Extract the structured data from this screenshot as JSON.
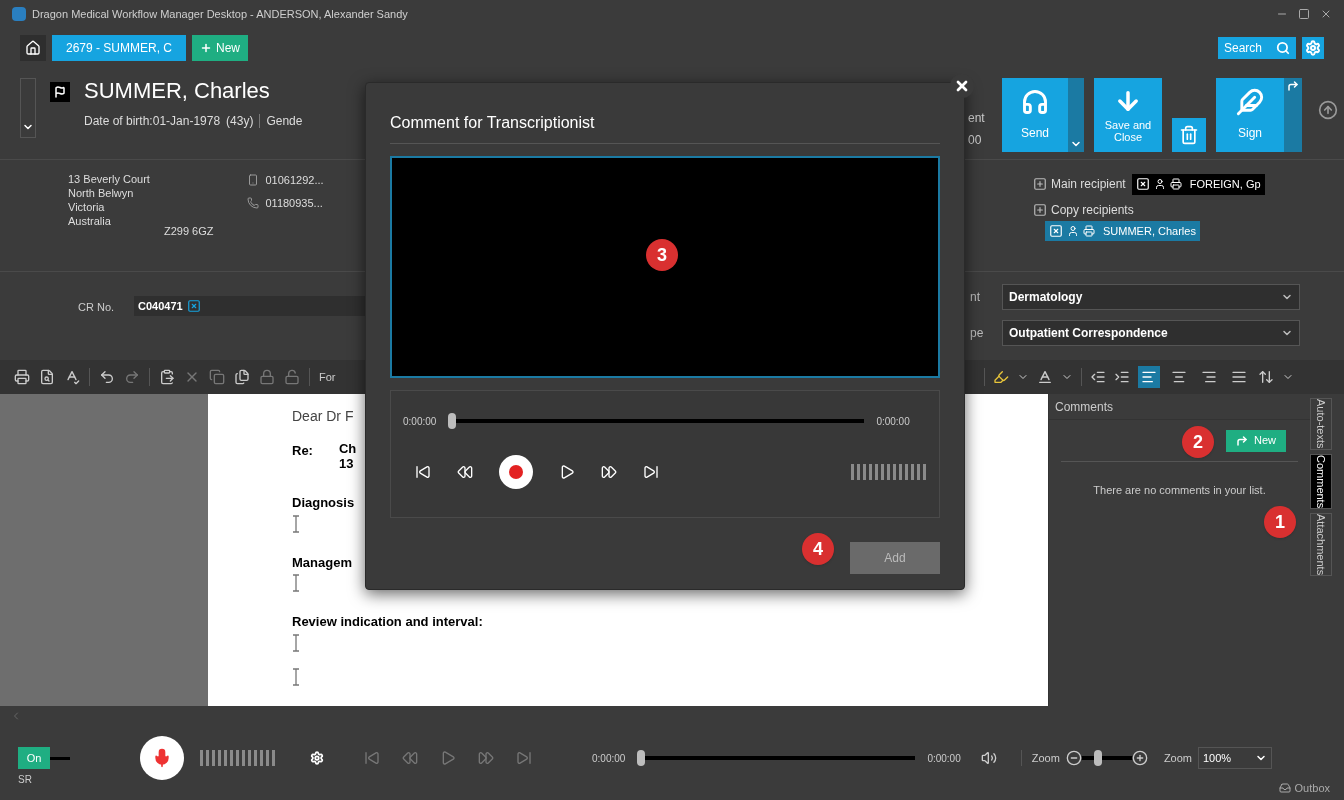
{
  "window": {
    "title": "Dragon Medical Workflow Manager Desktop - ANDERSON, Alexander Sandy"
  },
  "tabs": [
    {
      "label": "2679 - SUMMER, C",
      "selected": true
    }
  ],
  "new_tab_button": {
    "label": "New"
  },
  "search_button": {
    "label": "Search"
  },
  "patient": {
    "name": "SUMMER, Charles",
    "dob": "Date of birth:01-Jan-1978",
    "age": "(43y)",
    "gender_label": "Gende",
    "address": [
      "13 Beverly Court",
      "North Belwyn",
      "Victoria",
      "Australia"
    ],
    "postcode": "Z299 6GZ",
    "phones": [
      "01061292...",
      "01180935..."
    ]
  },
  "header_fragments": [
    "ent",
    "00"
  ],
  "actions": [
    {
      "label": "Send",
      "kind": "split"
    },
    {
      "label": "Save and Close",
      "kind": "plain"
    },
    {
      "kind": "trash"
    },
    {
      "label": "Sign",
      "kind": "share"
    }
  ],
  "recipients": {
    "main_label": "Main recipient",
    "main": "FOREIGN, Gp",
    "copy_label": "Copy recipients",
    "copies": [
      "SUMMER, Charles"
    ]
  },
  "cr": {
    "label": "CR No.",
    "value": "C040471"
  },
  "fields": [
    {
      "label": "nt",
      "value": "Dermatology"
    },
    {
      "label": "pe",
      "value": "Outpatient Correspondence"
    }
  ],
  "toolbar": {
    "font_label": "For",
    "align_buttons": [
      {
        "selected": true
      },
      {
        "selected": false
      },
      {
        "selected": false
      },
      {
        "selected": false
      }
    ]
  },
  "document": [
    {
      "kind": "greeting",
      "text": "Dear Dr F"
    },
    {
      "kind": "re",
      "label": "Re:",
      "lines": [
        "Ch",
        "13"
      ]
    },
    {
      "kind": "heading",
      "text": "Diagnosis"
    },
    {
      "kind": "cursor"
    },
    {
      "kind": "heading",
      "text": "Managem"
    },
    {
      "kind": "cursor"
    },
    {
      "kind": "heading",
      "text": "Review indication and interval:"
    },
    {
      "kind": "cursor"
    },
    {
      "kind": "cursor"
    }
  ],
  "comments_panel": {
    "title": "Comments",
    "new_button": "New",
    "empty_message": "There are no comments in your list."
  },
  "side_tabs": [
    {
      "label": "Auto-texts",
      "selected": false
    },
    {
      "label": "Comments",
      "selected": true
    },
    {
      "label": "Attachments",
      "selected": false
    }
  ],
  "dialog": {
    "title": "Comment for Transcriptionist",
    "time_start": "0:00:00",
    "time_end": "0:00:00",
    "level": 0,
    "add_button": {
      "label": "Add",
      "disabled": true
    }
  },
  "callouts": [
    "1",
    "2",
    "3",
    "4"
  ],
  "bottom_bar": {
    "sr_toggle": {
      "label": "On",
      "on": true
    },
    "sr_label": "SR",
    "time_start": "0:00:00",
    "time_end": "0:00:00",
    "level": 0,
    "zoom_label": "Zoom",
    "zoom_slider": {
      "level": 0.3
    },
    "zoom_label_2": "Zoom",
    "zoom_value": "100%",
    "outbox": "Outbox"
  }
}
